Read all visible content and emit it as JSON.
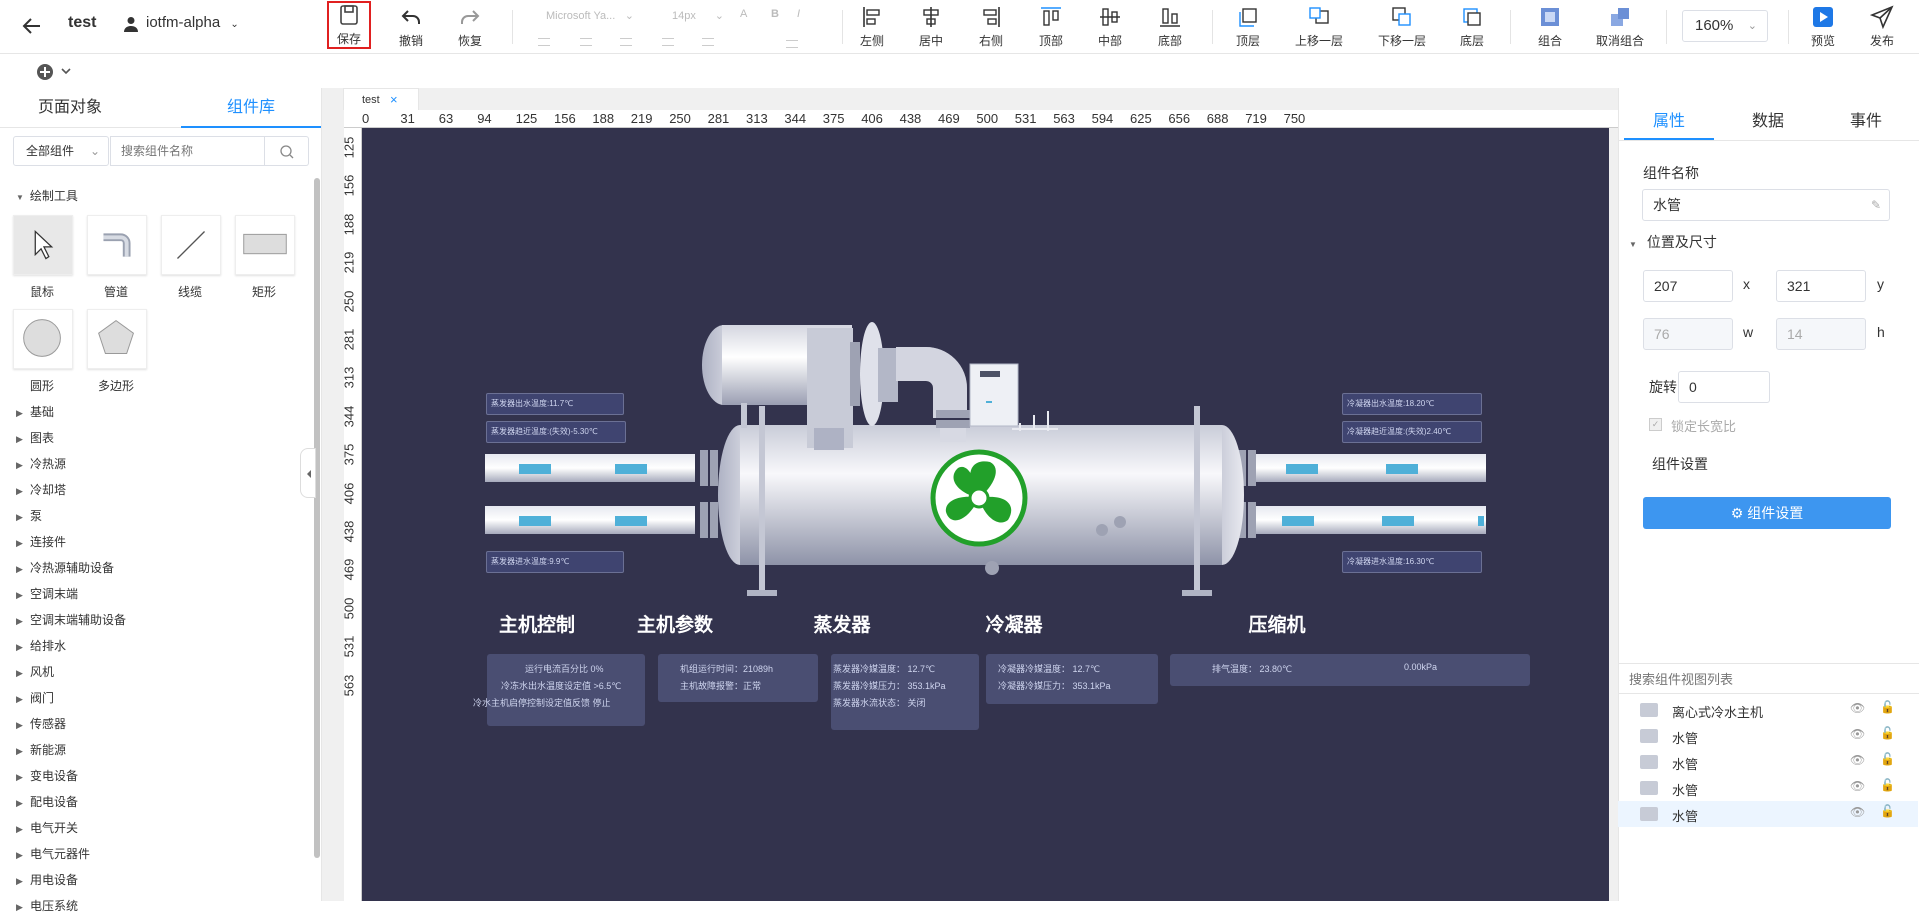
{
  "header": {
    "project": "test",
    "user": "iotfm-alpha",
    "font_family": "Microsoft Ya...",
    "font_size": "14px",
    "zoom": "160%"
  },
  "toolbar": {
    "save": "保存",
    "undo": "撤销",
    "redo": "恢复",
    "align_left": "左侧",
    "align_center": "居中",
    "align_right": "右侧",
    "align_top": "顶部",
    "align_middle": "中部",
    "align_bottom": "底部",
    "layer_top": "顶层",
    "layer_up": "上移一层",
    "layer_down": "下移一层",
    "layer_bottom": "底层",
    "group": "组合",
    "ungroup": "取消组合",
    "preview": "预览",
    "publish": "发布"
  },
  "left": {
    "tabs": [
      "页面对象",
      "组件库"
    ],
    "filter": "全部组件",
    "search_placeholder": "搜索组件名称",
    "section": "绘制工具",
    "tools": [
      "鼠标",
      "管道",
      "线缆",
      "矩形",
      "圆形",
      "多边形"
    ],
    "categories": [
      "基础",
      "图表",
      "冷热源",
      "冷却塔",
      "泵",
      "连接件",
      "冷热源辅助设备",
      "空调末端",
      "空调末端辅助设备",
      "给排水",
      "风机",
      "阀门",
      "传感器",
      "新能源",
      "变电设备",
      "配电设备",
      "电气开关",
      "电气元器件",
      "用电设备",
      "电压系统"
    ]
  },
  "canvas": {
    "tab": "test",
    "ruler_h": [
      "0",
      "31",
      "63",
      "94",
      "125",
      "156",
      "188",
      "219",
      "250",
      "281",
      "313",
      "344",
      "375",
      "406",
      "438",
      "469",
      "500",
      "531",
      "563",
      "594",
      "625",
      "656",
      "688",
      "719",
      "750"
    ],
    "ruler_v": [
      "125",
      "156",
      "188",
      "219",
      "250",
      "281",
      "313",
      "344",
      "375",
      "406",
      "438",
      "469",
      "500",
      "531",
      "563"
    ],
    "labels_left": [
      "蒸发器出水温度:11.7℃",
      "蒸发器趋近温度:(失效)-5.30℃",
      "蒸发器进水温度:9.9℃"
    ],
    "labels_right": [
      "冷凝器出水温度:18.20℃",
      "冷凝器趋近温度:(失效)2.40℃",
      "冷凝器进水温度:16.30℃"
    ],
    "sections": [
      {
        "title": "主机控制",
        "lines": [
          "运行电流百分比 0%",
          "冷冻水出水温度设定值 >6.5℃",
          "冷水主机启停控制设定值反馈 停止"
        ]
      },
      {
        "title": "主机参数",
        "lines": [
          "机组运行时间：21089h",
          "主机故障报警：正常"
        ]
      },
      {
        "title": "蒸发器",
        "lines": [
          "蒸发器冷媒温度： 12.7℃",
          "蒸发器冷媒压力： 353.1kPa",
          "蒸发器水流状态： 关闭"
        ]
      },
      {
        "title": "冷凝器",
        "lines": [
          "冷凝器冷媒温度： 12.7℃",
          "冷凝器冷媒压力： 353.1kPa"
        ]
      },
      {
        "title": "压缩机",
        "lines": [
          "排气温度： 23.80℃",
          "0.00kPa"
        ]
      }
    ]
  },
  "right": {
    "tabs": [
      "属性",
      "数据",
      "事件"
    ],
    "name_label": "组件名称",
    "name_value": "水管",
    "pos_section": "位置及尺寸",
    "x": "207",
    "x_label": "x",
    "y": "321",
    "y_label": "y",
    "w": "76",
    "w_label": "w",
    "h": "14",
    "h_label": "h",
    "rotate_label": "旋转",
    "rotate": "0",
    "lock_ratio": "锁定长宽比",
    "settings_label": "组件设置",
    "settings_button": "组件设置",
    "layer_search_placeholder": "搜索组件视图列表",
    "layers": [
      "离心式冷水主机",
      "水管",
      "水管",
      "水管",
      "水管"
    ]
  },
  "colors": {
    "accent": "#1e90ff",
    "stage_bg": "#33334d",
    "fan": "#22a02a",
    "pipe_mark": "#4fb0d8"
  }
}
